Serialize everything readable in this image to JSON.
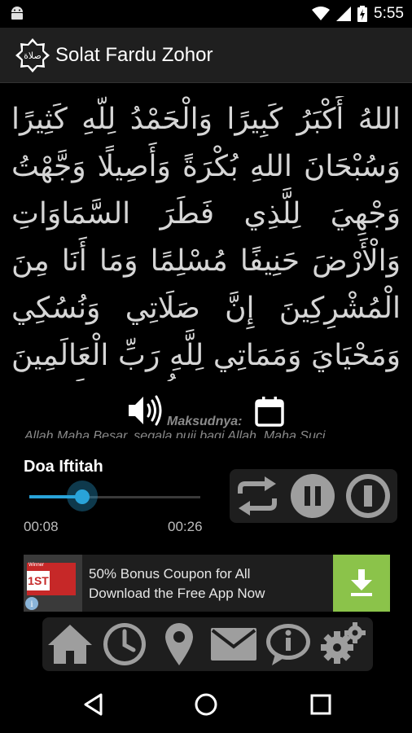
{
  "status_bar": {
    "time": "5:55",
    "icons": [
      "android-icon",
      "wifi-icon",
      "signal-icon",
      "battery-charging-icon"
    ]
  },
  "app_bar": {
    "logo_text": "صلاة",
    "title": "Solat Fardu Zohor"
  },
  "prayer": {
    "arabic_text": "اللهُ أَكْبَرُ كَبِيرًا وَالْحَمْدُ لِلَّهِ كَثِيرًا وَسُبْحَانَ اللهِ بُكْرَةً وَأَصِيلًا وَجَّهْتُ وَجْهِيَ لِلَّذِي فَطَرَ السَّمَاوَاتِ وَالْأَرْضَ حَنِيفًا مُسْلِمًا وَمَا أَنَا مِنَ الْمُشْرِكِينَ إِنَّ صَلَاتِي وَنُسُكِي وَمَحْيَايَ وَمَمَاتِي لِلَّهِ رَبِّ الْعَالَمِينَ لَا شَرِيكَ لَهُ وَبِذَلِكَ أُمِرْتُ وَأَنَا مِنَ الْمُسْلِمِينَ",
    "meaning_label": "Maksudnya:",
    "translation": "Allah Maha Besar, segala puji bagi Allah, Maha Suci"
  },
  "player": {
    "track_title": "Doa Iftitah",
    "current_time": "00:08",
    "total_time": "00:26",
    "progress": 0.31,
    "controls": [
      "repeat-icon",
      "pause-icon",
      "stop-icon"
    ]
  },
  "ad": {
    "badge": "1ST",
    "tag": "Winner",
    "info": "i",
    "line1": "50% Bonus Coupon for All",
    "line2": "Download the Free App Now"
  },
  "bottom_nav": [
    "home-icon",
    "clock-icon",
    "location-icon",
    "mail-icon",
    "info-icon",
    "settings-icon"
  ],
  "colors": {
    "accent": "#29a3d9",
    "panel": "#1e1e1e",
    "icon_gray": "#9e9e9e",
    "ad_green": "#8bc34a"
  }
}
